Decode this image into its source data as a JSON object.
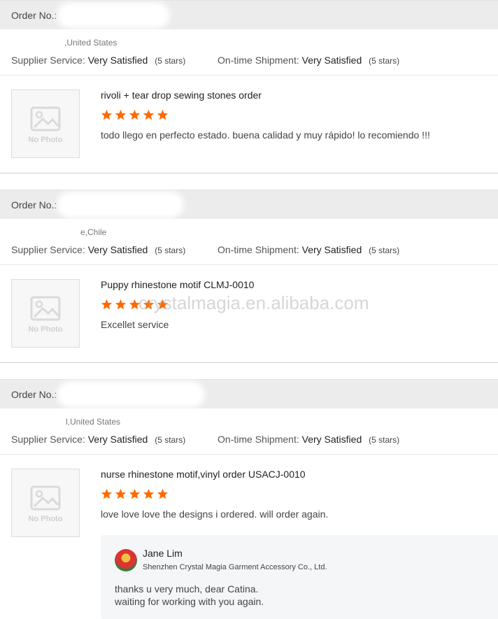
{
  "watermark": "crystalmagia.en.alibaba.com",
  "orders": [
    {
      "order_label": "Order No.:",
      "location": ",United States",
      "supplier_label": "Supplier Service:",
      "supplier_value": "Very Satisfied",
      "supplier_stars": "(5 stars)",
      "shipment_label": "On-time Shipment:",
      "shipment_value": "Very Satisfied",
      "shipment_stars": "(5 stars)",
      "no_photo": "No Photo",
      "product": "rivoli + tear drop sewing stones order",
      "rating": 5,
      "comment": "todo llego en perfecto estado. buena calidad y muy rápido! lo recomiendo !!!"
    },
    {
      "order_label": "Order No.:",
      "location": "e,Chile",
      "supplier_label": "Supplier Service:",
      "supplier_value": "Very Satisfied",
      "supplier_stars": "(5 stars)",
      "shipment_label": "On-time Shipment:",
      "shipment_value": "Very Satisfied",
      "shipment_stars": "(5 stars)",
      "no_photo": "No Photo",
      "product": "Puppy rhinestone motif CLMJ-0010",
      "rating": 5,
      "comment": "Excellet service"
    },
    {
      "order_label": "Order No.:",
      "location": "l,United States",
      "supplier_label": "Supplier Service:",
      "supplier_value": "Very Satisfied",
      "supplier_stars": "(5 stars)",
      "shipment_label": "On-time Shipment:",
      "shipment_value": "Very Satisfied",
      "shipment_stars": "(5 stars)",
      "no_photo": "No Photo",
      "product": "nurse rhinestone motif,vinyl order USACJ-0010",
      "rating": 5,
      "comment": "love love love the designs i ordered. will order again."
    }
  ],
  "reply": {
    "name": "Jane Lim",
    "company": "Shenzhen Crystal Magia Garment Accessory Co., Ltd.",
    "line1": "thanks u very much, dear Catina.",
    "line2": "waiting for working with you again."
  },
  "colors": {
    "star": "#ff6a00",
    "header_bg": "#ececec"
  }
}
